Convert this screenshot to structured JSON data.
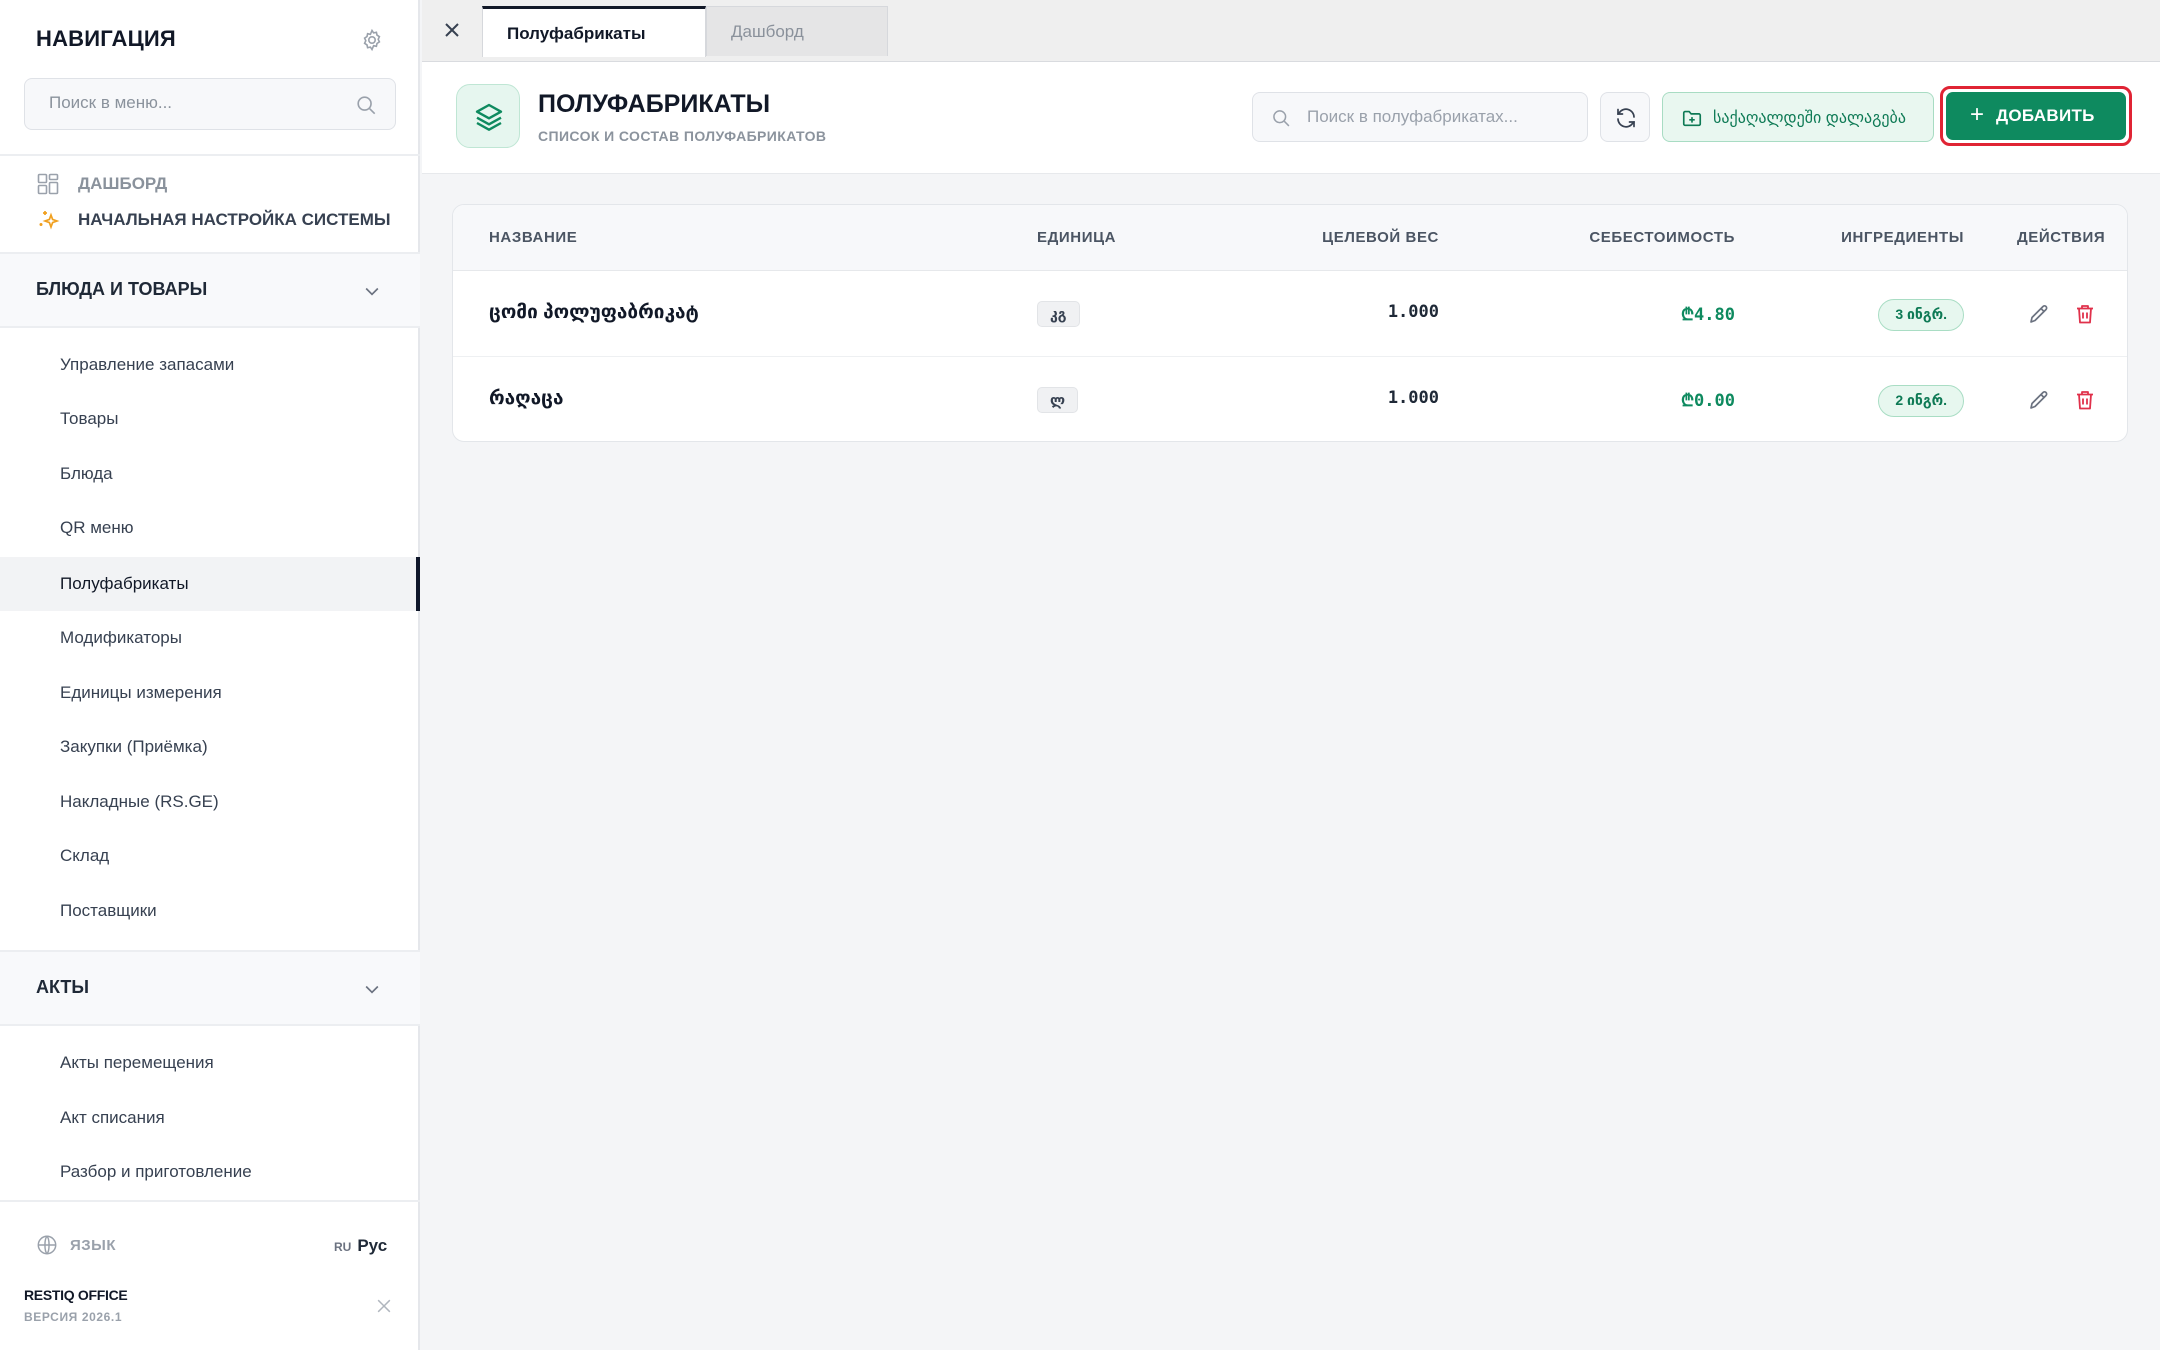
{
  "sidebar": {
    "title": "НАВИГАЦИЯ",
    "search_placeholder": "Поиск в меню...",
    "dashboard_label": "ДАШБОРД",
    "setup_label": "НАЧАЛЬНАЯ НАСТРОЙКА СИСТЕМЫ",
    "groups": [
      {
        "label": "БЛЮДА И ТОВАРЫ",
        "items": [
          {
            "label": "Управление запасами"
          },
          {
            "label": "Товары"
          },
          {
            "label": "Блюда"
          },
          {
            "label": "QR меню"
          },
          {
            "label": "Полуфабрикаты",
            "active": true
          },
          {
            "label": "Модификаторы"
          },
          {
            "label": "Единицы измерения"
          },
          {
            "label": "Закупки (Приёмка)"
          },
          {
            "label": "Накладные (RS.GE)"
          },
          {
            "label": "Склад"
          },
          {
            "label": "Поставщики"
          }
        ]
      },
      {
        "label": "АКТЫ",
        "items": [
          {
            "label": "Акты перемещения"
          },
          {
            "label": "Акт списания"
          },
          {
            "label": "Разбор и приготовление"
          }
        ]
      }
    ],
    "language_label": "ЯЗЫК",
    "language_code": "RU",
    "language_name": "Рус",
    "brand": "RESTIQ OFFICE",
    "version": "ВЕРСИЯ 2026.1"
  },
  "tabs": [
    {
      "label": "Полуфабрикаты",
      "active": true
    },
    {
      "label": "Дашборд",
      "active": false
    }
  ],
  "header": {
    "title": "ПОЛУФАБРИКАТЫ",
    "subtitle": "СПИСОК И СОСТАВ ПОЛУФАБРИКАТОВ",
    "search_placeholder": "Поиск в полуфабрикатах...",
    "folder_button": "საქაღალდეში დალაგება",
    "add_button": "ДОБАВИТЬ"
  },
  "table": {
    "columns": [
      "НАЗВАНИЕ",
      "ЕДИНИЦА",
      "ЦЕЛЕВОЙ ВЕС",
      "СЕБЕСТОИМОСТЬ",
      "ИНГРЕДИЕНТЫ",
      "ДЕЙСТВИЯ"
    ],
    "rows": [
      {
        "name": "ცომი პოლუფაბრიკატ",
        "unit": "კგ",
        "weight": "1.000",
        "cost": "₾4.80",
        "ingredients": "3 ინგრ."
      },
      {
        "name": "რაღაცა",
        "unit": "ლ",
        "weight": "1.000",
        "cost": "₾0.00",
        "ingredients": "2 ინგრ."
      }
    ]
  },
  "colors": {
    "accent": "#0e8a5f",
    "highlight": "#e02434",
    "danger": "#e0314b",
    "setup_icon": "#f0a020"
  },
  "icons": {
    "settings": "gear-icon",
    "search": "search-icon",
    "dashboard": "grid-icon",
    "setup": "sparkles-icon",
    "collapse": "chevron-down-icon",
    "language": "globe-icon",
    "close": "close-icon",
    "page": "layers-icon",
    "refresh": "refresh-icon",
    "folder": "folder-plus-icon",
    "edit": "pencil-icon",
    "delete": "trash-icon"
  }
}
